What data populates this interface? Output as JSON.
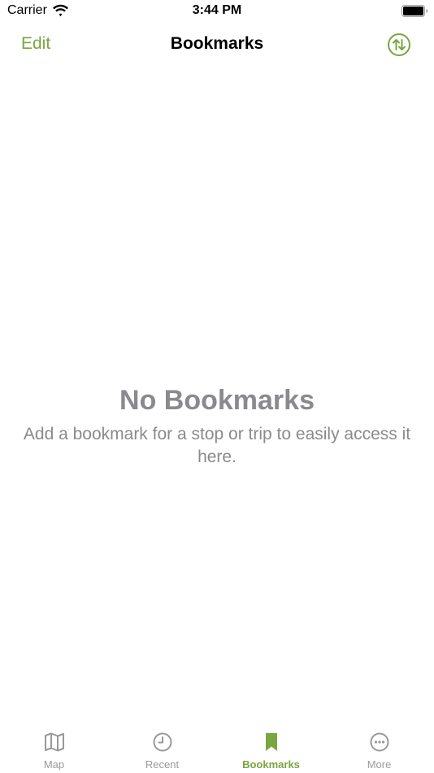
{
  "status_bar": {
    "carrier": "Carrier",
    "time": "3:44 PM"
  },
  "nav": {
    "edit_label": "Edit",
    "title": "Bookmarks",
    "sort_icon": "arrow-up-down-circle-icon"
  },
  "empty_state": {
    "title": "No Bookmarks",
    "message": "Add a bookmark for a stop or trip to easily access it here."
  },
  "tabs": [
    {
      "label": "Map",
      "icon": "map-icon",
      "active": false
    },
    {
      "label": "Recent",
      "icon": "clock-icon",
      "active": false
    },
    {
      "label": "Bookmarks",
      "icon": "bookmark-icon",
      "active": true
    },
    {
      "label": "More",
      "icon": "ellipsis-circle-icon",
      "active": false
    }
  ],
  "colors": {
    "accent": "#78a640",
    "inactive": "#999999",
    "empty_text": "#8a8a8e"
  }
}
